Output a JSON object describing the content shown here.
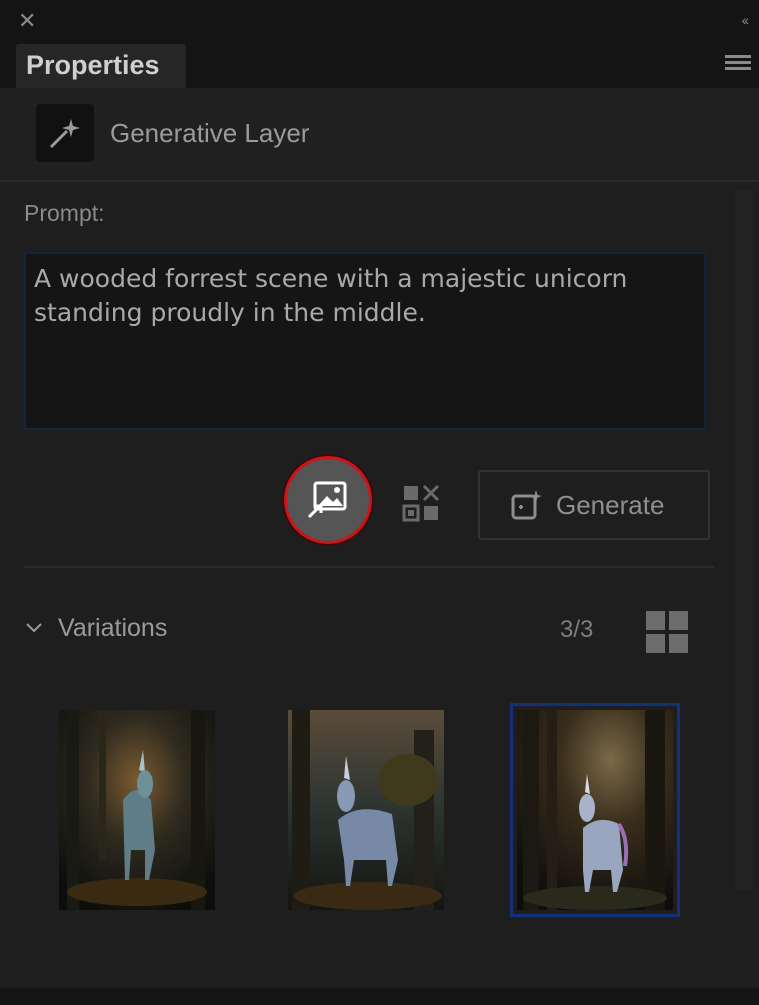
{
  "window": {
    "close_glyph": "✕",
    "collapse_glyph": "‹‹"
  },
  "panel": {
    "tab_label": "Properties"
  },
  "layer": {
    "title": "Generative Layer"
  },
  "prompt": {
    "label": "Prompt:",
    "value": "A wooded forrest scene with a majestic unicorn standing proudly in the middle."
  },
  "actions": {
    "generate_label": "Generate"
  },
  "variations": {
    "label": "Variations",
    "count": "3/3",
    "selected_index": 2,
    "items": [
      {
        "name": "variation-1"
      },
      {
        "name": "variation-2"
      },
      {
        "name": "variation-3"
      }
    ]
  },
  "colors": {
    "highlight_ring": "#c9151c",
    "selection": "#15307a",
    "panel_bg": "#1e1e1e"
  }
}
